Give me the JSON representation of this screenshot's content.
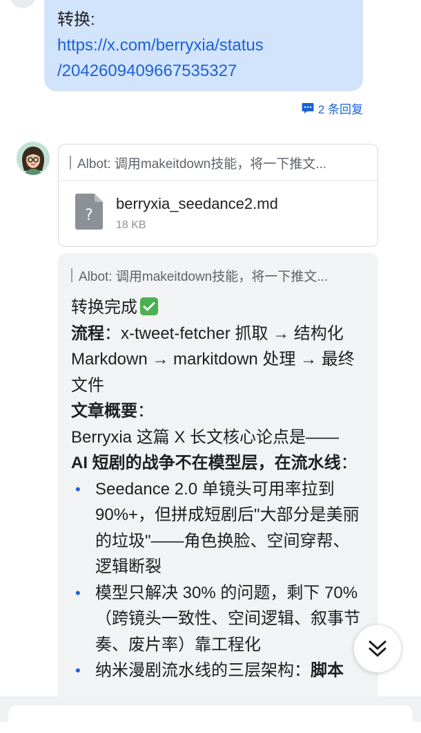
{
  "user_message": {
    "prefix": "转换:",
    "link_line1": "https://x.com/berryxia/status",
    "link_line2": "/2042609409667535327"
  },
  "thread": {
    "reply_count_label": "2 条回复",
    "icon": "comment-icon"
  },
  "bot": {
    "avatar": "avatar-icon",
    "file_card": {
      "quote": "Albot: 调用makeitdown技能，将一下推文...",
      "file_name": "berryxia_seedance2.md",
      "file_size": "18 KB",
      "file_icon_glyph": "?"
    },
    "reply": {
      "quote": "Albot: 调用makeitdown技能，将一下推文...",
      "status": "转换完成",
      "flow_label": "流程",
      "flow_text": "：x-tweet-fetcher 抓取 → 结构化 Markdown → markitdown 处理 → 最终文件",
      "summary_label": "文章概要",
      "summary_colon": "：",
      "summary_intro": "Berryxia 这篇 X 长文核心论点是——",
      "thesis_bold": "AI 短剧的战争不在模型层，在流水线",
      "thesis_colon": "：",
      "bullets": [
        "Seedance 2.0 单镜头可用率拉到 90%+，但拼成短剧后\"大部分是美丽的垃圾\"——角色换脸、空间穿帮、逻辑断裂",
        "模型只解决 30% 的问题，剩下 70%（跨镜头一致性、空间逻辑、叙事节奏、废片率）靠工程化"
      ],
      "bullet3_plain": "纳米漫剧流水线的三层架构：",
      "bullet3_bold": "脚本"
    }
  },
  "controls": {
    "scroll_down_icon": "double-chevron-down-icon"
  }
}
